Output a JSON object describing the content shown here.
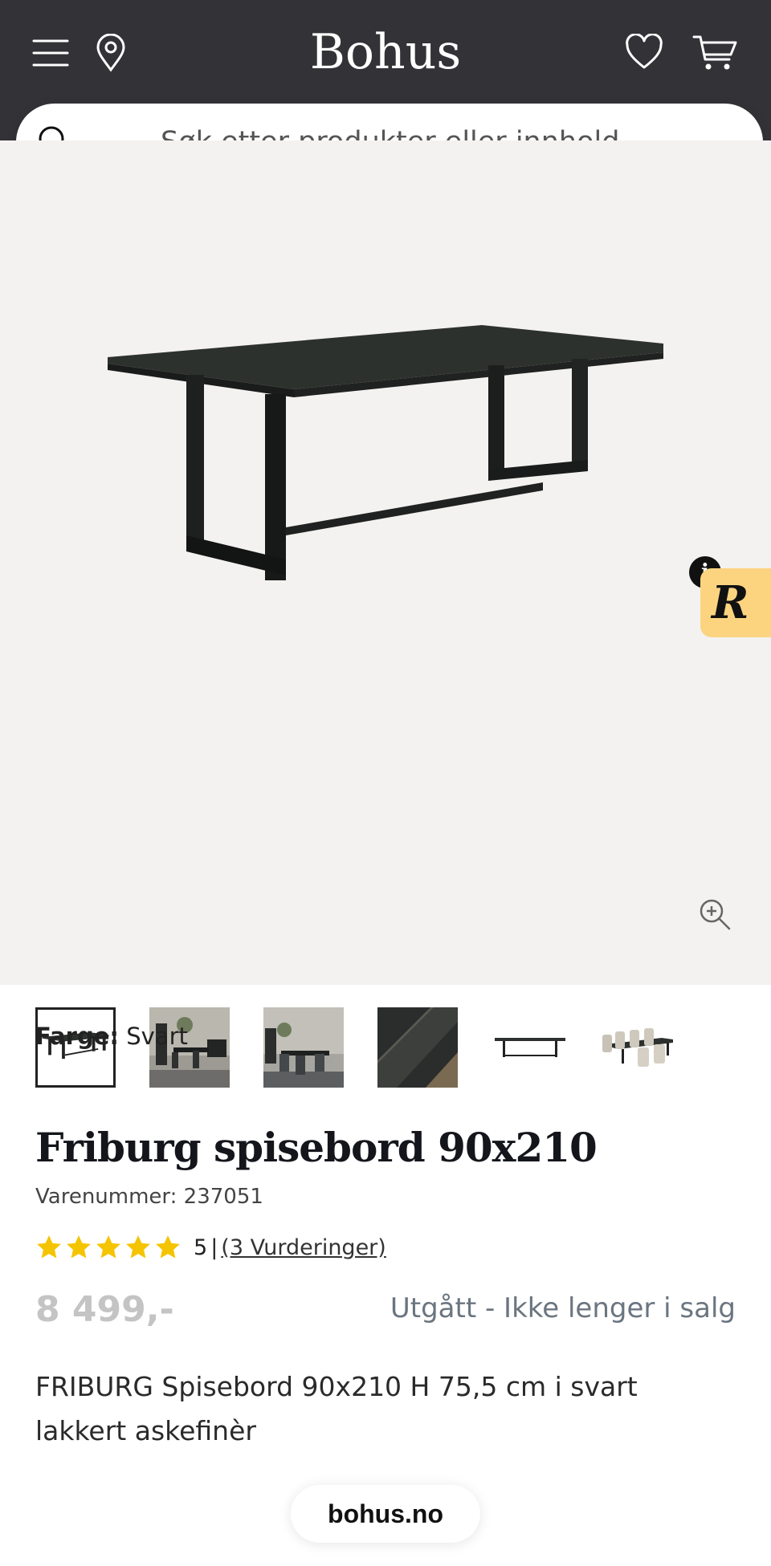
{
  "header": {
    "logo": "Bohus",
    "icons": [
      "menu-icon",
      "location-pin-icon",
      "heart-icon",
      "cart-icon"
    ],
    "background": "#333236"
  },
  "search": {
    "placeholder": "Søk etter produkter eller innhold ..."
  },
  "gallery": {
    "thumbnail_count": 6,
    "active_thumbnail": 1,
    "review_widget_letter": "R",
    "review_info_glyph": "i"
  },
  "product": {
    "color_label": "Farge:",
    "color_value": "Svart",
    "title": "Friburg spisebord 90x210",
    "sku": "Varenummer: 237051",
    "rating_value": 5,
    "rating_score_text": "5",
    "rating_separator": "|",
    "rating_count": "(3 Vurderinger)",
    "price": "8 499,-",
    "status": "Utgått - Ikke lenger i salg",
    "description": "FRIBURG Spisebord 90x210 H 75,5 cm i svart lakkert askefinèr"
  },
  "footer": {
    "domain": "bohus.no"
  },
  "colors": {
    "header_bg": "#333236",
    "gallery_bg": "#f3f2f0",
    "star": "#f5c400",
    "price": "#c4c4c4",
    "status": "#6b7580",
    "review_widget": "#fcd480"
  }
}
